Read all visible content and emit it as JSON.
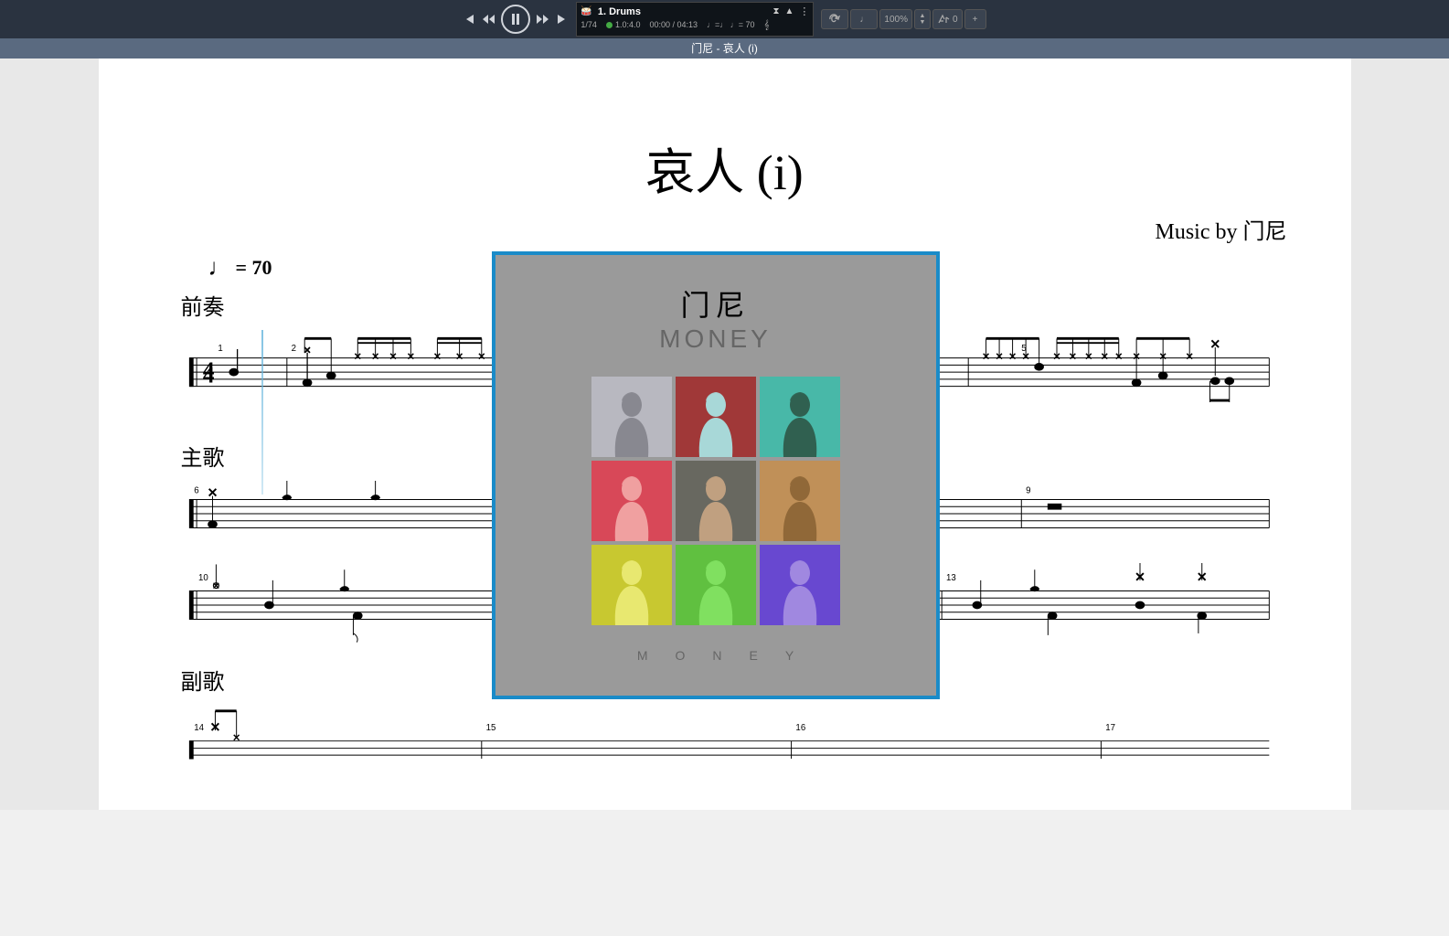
{
  "transport": {
    "track_label": "1. Drums",
    "position": "1/74",
    "time_sig": "1.0:4.0",
    "time": "00:00 / 04:13",
    "tempo_display": "♩=♩ ♩= 70"
  },
  "toolbar": {
    "zoom": "100%",
    "capo": "0"
  },
  "document": {
    "window_title": "门尼 - 哀人 (i)",
    "title": "哀人 (i)",
    "composer": "Music by 门尼",
    "tempo": "= 70",
    "sections": {
      "intro": "前奏",
      "verse": "主歌",
      "chorus": "副歌"
    },
    "time_signature": "4/4",
    "bar_numbers_line1": [
      "1",
      "2",
      "5"
    ],
    "bar_numbers_line2": [
      "6",
      "9"
    ],
    "bar_numbers_line3": [
      "10",
      "13"
    ],
    "bar_numbers_line4": [
      "14",
      "15",
      "16",
      "17"
    ]
  },
  "album": {
    "artist_cn": "门尼",
    "artist_en": "MONEY",
    "footer": "MONEY",
    "grid_colors": [
      {
        "bg": "#b8b8c0",
        "fg": "#888890"
      },
      {
        "bg": "#a03838",
        "fg": "#a8d8d8"
      },
      {
        "bg": "#48b8a8",
        "fg": "#306050"
      },
      {
        "bg": "#d84858",
        "fg": "#f0a0a0"
      },
      {
        "bg": "#686860",
        "fg": "#c0a080"
      },
      {
        "bg": "#c09058",
        "fg": "#906838"
      },
      {
        "bg": "#c8c830",
        "fg": "#e8e870"
      },
      {
        "bg": "#60c040",
        "fg": "#80e060"
      },
      {
        "bg": "#6848d0",
        "fg": "#a088e0"
      }
    ]
  }
}
